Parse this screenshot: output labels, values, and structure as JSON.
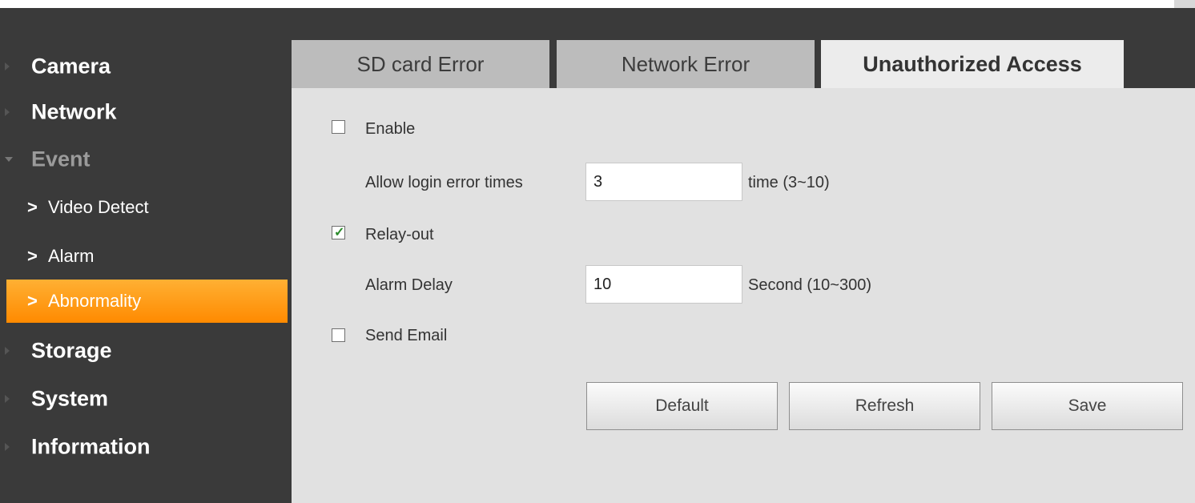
{
  "sidebar": {
    "items": [
      {
        "label": "Camera"
      },
      {
        "label": "Network"
      },
      {
        "label": "Event"
      },
      {
        "label": "Video Detect"
      },
      {
        "label": "Alarm"
      },
      {
        "label": "Abnormality"
      },
      {
        "label": "Storage"
      },
      {
        "label": "System"
      },
      {
        "label": "Information"
      }
    ],
    "active_color": "#ff9a1a"
  },
  "tabs": [
    {
      "label": "SD card Error"
    },
    {
      "label": "Network Error"
    },
    {
      "label": "Unauthorized Access"
    }
  ],
  "form": {
    "enable": {
      "label": "Enable",
      "checked": false
    },
    "login_error": {
      "label": "Allow login error times",
      "value": "3",
      "unit": "time (3~10)"
    },
    "relay_out": {
      "label": "Relay-out",
      "checked": true
    },
    "alarm_delay": {
      "label": "Alarm Delay",
      "value": "10",
      "unit": "Second (10~300)"
    },
    "send_email": {
      "label": "Send Email",
      "checked": false
    }
  },
  "buttons": {
    "default": "Default",
    "refresh": "Refresh",
    "save": "Save"
  },
  "icons": {
    "checkmark": "✓",
    "chevron": "›"
  }
}
